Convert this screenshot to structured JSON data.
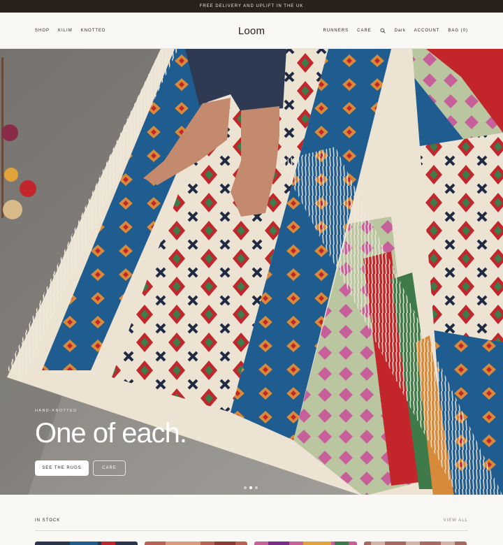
{
  "announcement": "FREE DELIVERY AND UPLIFT IN THE UK",
  "header": {
    "logo": "Loom",
    "nav_left": [
      "SHOP",
      "KILIM",
      "KNOTTED"
    ],
    "nav_right": {
      "runners": "RUNNERS",
      "care": "CARE",
      "theme": "Dark",
      "account": "ACCOUNT",
      "bag": "BAG (0)"
    },
    "search_icon": "search-icon"
  },
  "hero": {
    "eyebrow": "HAND-KNOTTED",
    "title": "One of each.",
    "primary_cta": "SEE THE RUGS",
    "secondary_cta": "CARE",
    "slides": 3,
    "active_slide": 2
  },
  "stock": {
    "title": "IN STOCK",
    "view_all": "VIEW ALL"
  },
  "colors": {
    "bar": "#2b211b",
    "background": "#faf8f4",
    "rug_blue": "#1f5c8f",
    "rug_red": "#c2262b",
    "rug_cream": "#ece3d2",
    "rug_green": "#3f7a4a"
  }
}
